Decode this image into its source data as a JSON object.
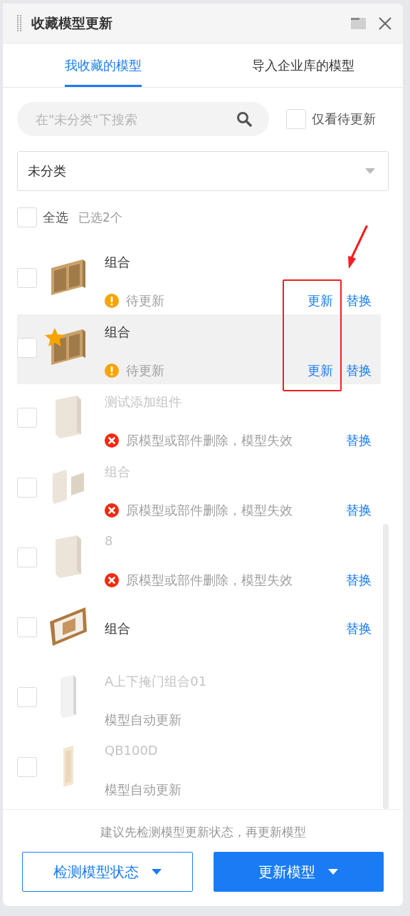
{
  "window": {
    "title": "收藏模型更新"
  },
  "tabs": [
    {
      "label": "我收藏的模型",
      "selected": true
    },
    {
      "label": "导入企业库的模型",
      "selected": false
    }
  ],
  "search": {
    "placeholder": "在\"未分类\"下搜索"
  },
  "pending_only": {
    "label": "仅看待更新",
    "checked": false
  },
  "category": {
    "value": "未分类"
  },
  "select_all": {
    "label": "全选",
    "checked": false,
    "count": "已选2个"
  },
  "items": [
    {
      "kind": "pending",
      "name": "组合",
      "status": "待更新",
      "update": "更新",
      "replace": "替换",
      "checked": false,
      "highlighted": false,
      "starred": false
    },
    {
      "kind": "pending",
      "name": "组合",
      "status": "待更新",
      "update": "更新",
      "replace": "替换",
      "checked": false,
      "highlighted": true,
      "starred": true
    },
    {
      "kind": "invalid",
      "name": "测试添加组件",
      "status": "原模型或部件删除，模型失效",
      "replace": "替换",
      "checked": false,
      "highlighted": false,
      "starred": false
    },
    {
      "kind": "invalid",
      "name": "组合",
      "status": "原模型或部件删除，模型失效",
      "replace": "替换",
      "checked": false,
      "highlighted": false,
      "starred": false
    },
    {
      "kind": "invalid",
      "name": "8",
      "status": "原模型或部件删除，模型失效",
      "replace": "替换",
      "checked": false,
      "highlighted": false,
      "starred": false
    },
    {
      "kind": "normal",
      "name": "组合",
      "replace": "替换",
      "checked": false,
      "highlighted": false,
      "starred": false
    },
    {
      "kind": "auto",
      "name": "A上下掩门组合01",
      "status": "模型自动更新",
      "checked": false,
      "highlighted": false,
      "starred": false
    },
    {
      "kind": "auto",
      "name": "QB100D",
      "status": "模型自动更新",
      "checked": false,
      "highlighted": false,
      "starred": false
    }
  ],
  "hint": "建议先检测模型更新状态，再更新模型",
  "buttons": [
    {
      "label": "检测模型状态",
      "kind": "outline"
    },
    {
      "label": "更新模型",
      "kind": "primary"
    }
  ]
}
